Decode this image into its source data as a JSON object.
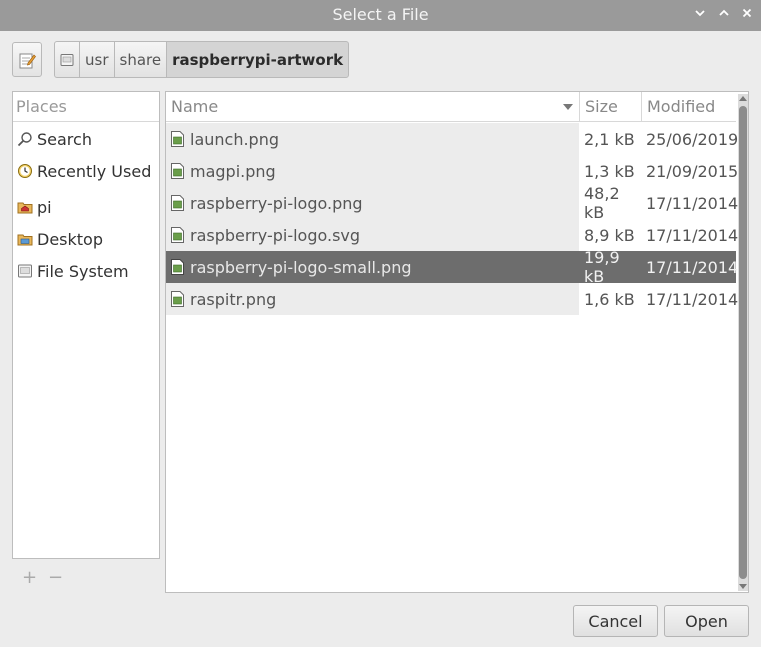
{
  "window": {
    "title": "Select a File"
  },
  "pathbar": {
    "crumbs": [
      "usr",
      "share",
      "raspberrypi-artwork"
    ]
  },
  "places": {
    "header": "Places",
    "items": [
      {
        "label": "Search",
        "icon": "search-icon"
      },
      {
        "label": "Recently Used",
        "icon": "clock-icon"
      },
      {
        "label": "pi",
        "icon": "home-folder-icon"
      },
      {
        "label": "Desktop",
        "icon": "desktop-folder-icon"
      },
      {
        "label": "File System",
        "icon": "drive-icon"
      }
    ],
    "add": "+",
    "remove": "−"
  },
  "columns": {
    "name": "Name",
    "size": "Size",
    "modified": "Modified"
  },
  "files": [
    {
      "name": "launch.png",
      "size": "2,1 kB",
      "modified": "25/06/2019"
    },
    {
      "name": "magpi.png",
      "size": "1,3 kB",
      "modified": "21/09/2015"
    },
    {
      "name": "raspberry-pi-logo.png",
      "size": "48,2 kB",
      "modified": "17/11/2014"
    },
    {
      "name": "raspberry-pi-logo.svg",
      "size": "8,9 kB",
      "modified": "17/11/2014"
    },
    {
      "name": "raspberry-pi-logo-small.png",
      "size": "19,9 kB",
      "modified": "17/11/2014",
      "selected": true
    },
    {
      "name": "raspitr.png",
      "size": "1,6 kB",
      "modified": "17/11/2014"
    }
  ],
  "buttons": {
    "cancel": "Cancel",
    "open": "Open"
  },
  "colors": {
    "titlebar": "#9a9a9a",
    "selection": "#6d6d6d",
    "dialog_bg": "#ececec"
  }
}
